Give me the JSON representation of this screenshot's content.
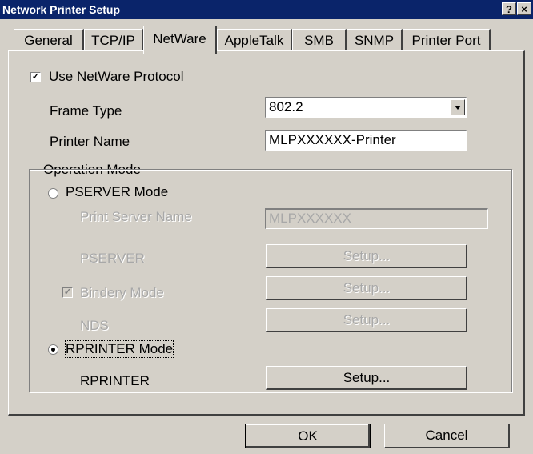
{
  "window": {
    "title": "Network Printer Setup",
    "help_glyph": "?",
    "close_glyph": "×"
  },
  "tabs": [
    {
      "label": "General",
      "selected": false
    },
    {
      "label": "TCP/IP",
      "selected": false
    },
    {
      "label": "NetWare",
      "selected": true
    },
    {
      "label": "AppleTalk",
      "selected": false
    },
    {
      "label": "SMB",
      "selected": false
    },
    {
      "label": "SNMP",
      "selected": false
    },
    {
      "label": "Printer Port",
      "selected": false
    }
  ],
  "netware": {
    "use_protocol": {
      "label": "Use NetWare Protocol",
      "checked": true
    },
    "frame_type": {
      "label": "Frame Type",
      "value": "802.2"
    },
    "printer_name": {
      "label": "Printer Name",
      "value": "MLPXXXXXX-Printer"
    },
    "operation_mode": {
      "label": "Operation Mode",
      "pserver_mode": {
        "label": "PSERVER Mode",
        "selected": false
      },
      "print_server_name": {
        "label": "Print Server Name",
        "value": "MLPXXXXXX",
        "enabled": false
      },
      "pserver": {
        "label": "PSERVER",
        "button": "Setup...",
        "enabled": false
      },
      "bindery_mode": {
        "label": "Bindery Mode",
        "checked": true,
        "enabled": false,
        "button": "Setup..."
      },
      "nds": {
        "label": "NDS",
        "button": "Setup...",
        "enabled": false
      },
      "rprinter_mode": {
        "label": "RPRINTER Mode",
        "selected": true
      },
      "rprinter": {
        "label": "RPRINTER",
        "button": "Setup...",
        "enabled": true
      }
    }
  },
  "buttons": {
    "ok": "OK",
    "cancel": "Cancel"
  },
  "glyphs": {
    "check": "✓"
  },
  "colors": {
    "title_bar": "#0a246a",
    "face": "#d4d0c8",
    "disabled_text": "#a8a8a8"
  }
}
